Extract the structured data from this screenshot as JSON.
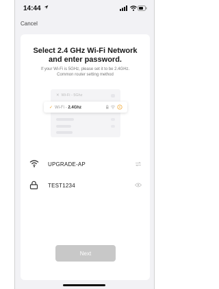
{
  "status_bar": {
    "time": "14:44",
    "icons": [
      "location-arrow-icon",
      "signal-icon",
      "wifi-icon",
      "battery-icon"
    ]
  },
  "nav": {
    "cancel_label": "Cancel"
  },
  "header": {
    "title_line1": "Select 2.4 GHz Wi-Fi Network",
    "title_line2": "and enter password.",
    "subtitle_line1": "If your Wi-Fi is 5GHz, please set it to be 2.4GHz.",
    "subtitle_line2": "Common router setting method"
  },
  "illustration": {
    "option_5g_prefix": "Wi-Fi - ",
    "option_5g_band": "5Ghz",
    "option_24_prefix": "Wi-Fi - ",
    "option_24_band": "2.4Ghz"
  },
  "form": {
    "network": {
      "value": "UPGRADE-AP",
      "icon": "wifi-icon",
      "action_icon": "switch-network-icon"
    },
    "password": {
      "value": "TEST1234",
      "icon": "lock-icon",
      "action_icon": "eye-icon"
    }
  },
  "actions": {
    "next_label": "Next"
  },
  "colors": {
    "background": "#f2f2f5",
    "card": "#ffffff",
    "button_disabled": "#c8c8c8",
    "accent_check": "#f0a020"
  }
}
